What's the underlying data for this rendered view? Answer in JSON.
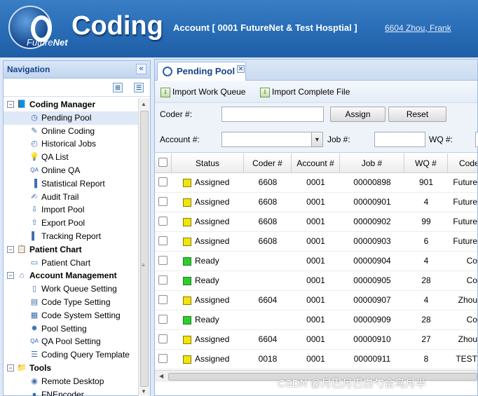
{
  "header": {
    "logo_text": "Future",
    "logo_text2": "Net",
    "app_title": "Coding",
    "account_line": "Account [  0001 FutureNet & Test Hosptial  ]",
    "user_link": "6604 Zhou, Frank"
  },
  "nav": {
    "title": "Navigation",
    "collapse_glyph": "«",
    "tree": [
      {
        "label": "Coding Manager",
        "level": 0,
        "icon": "book-icon",
        "glyph": "📘",
        "toggle": "−"
      },
      {
        "label": "Pending Pool",
        "level": 1,
        "icon": "clock-icon",
        "glyph": "◷",
        "selected": true
      },
      {
        "label": "Online Coding",
        "level": 1,
        "icon": "pencil-icon",
        "glyph": "✎"
      },
      {
        "label": "Historical Jobs",
        "level": 1,
        "icon": "history-icon",
        "glyph": "◴"
      },
      {
        "label": "QA List",
        "level": 1,
        "icon": "qa-list-icon",
        "glyph": "💡"
      },
      {
        "label": "Online QA",
        "level": 1,
        "icon": "qa-icon",
        "glyph": "QA"
      },
      {
        "label": "Statistical Report",
        "level": 1,
        "icon": "bar-chart-icon",
        "glyph": "▐"
      },
      {
        "label": "Audit Trail",
        "level": 1,
        "icon": "audit-icon",
        "glyph": "✍"
      },
      {
        "label": "Import Pool",
        "level": 1,
        "icon": "import-icon",
        "glyph": "⇩"
      },
      {
        "label": "Export Pool",
        "level": 1,
        "icon": "export-icon",
        "glyph": "⇧"
      },
      {
        "label": "Tracking Report",
        "level": 1,
        "icon": "tracking-icon",
        "glyph": "▌"
      },
      {
        "label": "Patient Chart",
        "level": 0,
        "icon": "clipboard-icon",
        "glyph": "📋",
        "toggle": "−"
      },
      {
        "label": "Patient Chart",
        "level": 1,
        "icon": "chart-doc-icon",
        "glyph": "▭"
      },
      {
        "label": "Account Management",
        "level": 0,
        "icon": "house-icon",
        "glyph": "⌂",
        "toggle": "−"
      },
      {
        "label": "Work Queue Setting",
        "level": 1,
        "icon": "document-icon",
        "glyph": "▯"
      },
      {
        "label": "Code Type Setting",
        "level": 1,
        "icon": "code-book-icon",
        "glyph": "▤"
      },
      {
        "label": "Code System Setting",
        "level": 1,
        "icon": "code-system-icon",
        "glyph": "▦"
      },
      {
        "label": "Pool Setting",
        "level": 1,
        "icon": "pool-gear-icon",
        "glyph": "✹"
      },
      {
        "label": "QA Pool Setting",
        "level": 1,
        "icon": "qa-pool-icon",
        "glyph": "QA"
      },
      {
        "label": "Coding Query Template",
        "level": 1,
        "icon": "template-icon",
        "glyph": "☰"
      },
      {
        "label": "Tools",
        "level": 0,
        "icon": "folder-icon",
        "glyph": "📁",
        "toggle": "−"
      },
      {
        "label": "Remote Desktop",
        "level": 1,
        "icon": "remote-desktop-icon",
        "glyph": "◉"
      },
      {
        "label": "FNEncoder",
        "level": 1,
        "icon": "encoder-icon",
        "glyph": "●"
      }
    ]
  },
  "main": {
    "tab_label": "Pending Pool",
    "toolbar": {
      "import_wq": "Import Work Queue",
      "import_file": "Import Complete File"
    },
    "form": {
      "coder_label": "Coder #:",
      "coder_value": "",
      "assign": "Assign",
      "reset": "Reset",
      "account_label": "Account #:",
      "account_value": "",
      "job_label": "Job #:",
      "job_value": "",
      "wq_label": "WQ #:"
    },
    "grid": {
      "columns": [
        "Status",
        "Coder #",
        "Account #",
        "Job #",
        "WQ #",
        "Code"
      ],
      "rows": [
        {
          "status": "Assigned",
          "color": "#f1e40c",
          "coder": "6608",
          "account": "0001",
          "job": "00000898",
          "wq": "901",
          "code": "Future"
        },
        {
          "status": "Assigned",
          "color": "#f1e40c",
          "coder": "6608",
          "account": "0001",
          "job": "00000901",
          "wq": "4",
          "code": "Future"
        },
        {
          "status": "Assigned",
          "color": "#f1e40c",
          "coder": "6608",
          "account": "0001",
          "job": "00000902",
          "wq": "99",
          "code": "Future"
        },
        {
          "status": "Assigned",
          "color": "#f1e40c",
          "coder": "6608",
          "account": "0001",
          "job": "00000903",
          "wq": "6",
          "code": "Future"
        },
        {
          "status": "Ready",
          "color": "#2fcc2f",
          "coder": "",
          "account": "0001",
          "job": "00000904",
          "wq": "4",
          "code": "Co"
        },
        {
          "status": "Ready",
          "color": "#2fcc2f",
          "coder": "",
          "account": "0001",
          "job": "00000905",
          "wq": "28",
          "code": "Co"
        },
        {
          "status": "Assigned",
          "color": "#f1e40c",
          "coder": "6604",
          "account": "0001",
          "job": "00000907",
          "wq": "4",
          "code": "Zhou"
        },
        {
          "status": "Ready",
          "color": "#2fcc2f",
          "coder": "",
          "account": "0001",
          "job": "00000909",
          "wq": "28",
          "code": "Co"
        },
        {
          "status": "Assigned",
          "color": "#f1e40c",
          "coder": "6604",
          "account": "0001",
          "job": "00000910",
          "wq": "27",
          "code": "Zhou"
        },
        {
          "status": "Assigned",
          "color": "#f1e40c",
          "coder": "0018",
          "account": "0001",
          "job": "00000911",
          "wq": "8",
          "code": "TEST"
        }
      ]
    }
  },
  "watermark": "CSDN @月巴月巴白勺合鸟月半"
}
